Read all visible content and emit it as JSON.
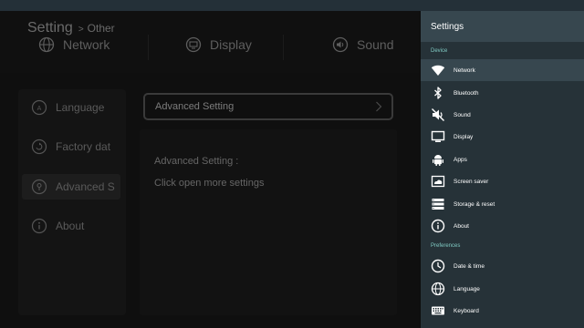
{
  "app": {
    "breadcrumb_main": "Setting",
    "breadcrumb_sep": ">",
    "breadcrumb_sub": "Other"
  },
  "top_tabs": [
    {
      "label": "Network",
      "icon": "globe-icon"
    },
    {
      "label": "Display",
      "icon": "display-icon"
    },
    {
      "label": "Sound",
      "icon": "speaker-icon"
    }
  ],
  "left_menu": [
    {
      "label": "Language",
      "icon": "language-icon"
    },
    {
      "label": "Factory dat",
      "icon": "factory-reset-icon"
    },
    {
      "label": "Advanced S",
      "icon": "advanced-icon"
    },
    {
      "label": "About",
      "icon": "info-icon"
    }
  ],
  "advanced_button": {
    "label": "Advanced Setting"
  },
  "description": {
    "title": "Advanced Setting :",
    "text": "Click open more settings"
  },
  "drawer": {
    "title": "Settings",
    "sections": {
      "device": "Device",
      "preferences": "Preferences"
    },
    "items": [
      {
        "label": "Network",
        "icon": "wifi-icon"
      },
      {
        "label": "Bluetooth",
        "icon": "bluetooth-icon"
      },
      {
        "label": "Sound",
        "icon": "sound-off-icon"
      },
      {
        "label": "Display",
        "icon": "monitor-icon"
      },
      {
        "label": "Apps",
        "icon": "android-icon"
      },
      {
        "label": "Screen saver",
        "icon": "screensaver-icon"
      },
      {
        "label": "Storage & reset",
        "icon": "storage-icon"
      },
      {
        "label": "About",
        "icon": "info-icon"
      },
      {
        "label": "Date & time",
        "icon": "clock-icon"
      },
      {
        "label": "Language",
        "icon": "language-icon"
      },
      {
        "label": "Keyboard",
        "icon": "keyboard-icon"
      }
    ]
  },
  "colors": {
    "drawer_bg": "#263238",
    "drawer_header": "#37474f",
    "section_accent": "#80cbc4",
    "background": "#0c0c0c"
  }
}
